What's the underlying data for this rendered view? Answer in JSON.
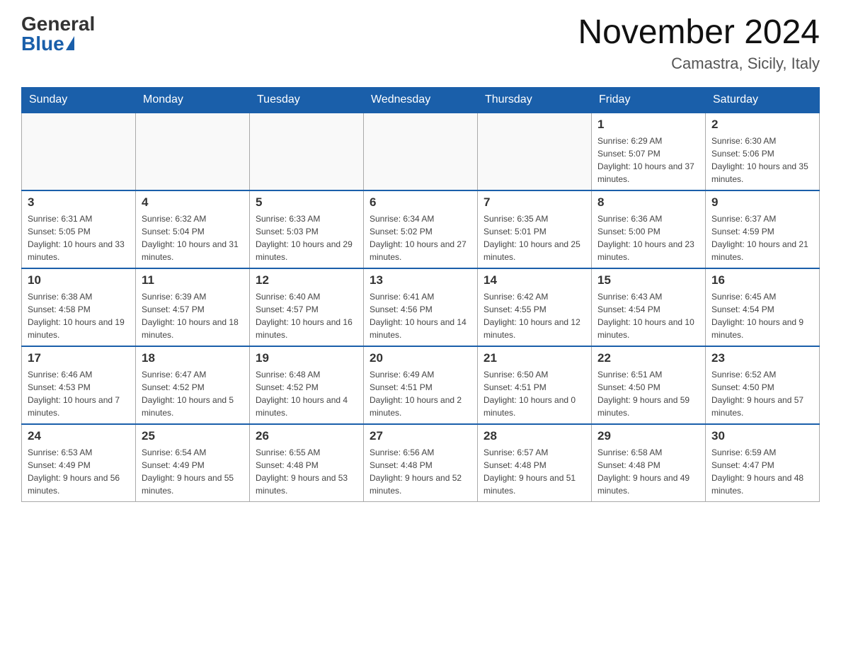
{
  "header": {
    "logo_general": "General",
    "logo_blue": "Blue",
    "month_title": "November 2024",
    "location": "Camastra, Sicily, Italy"
  },
  "days_of_week": [
    "Sunday",
    "Monday",
    "Tuesday",
    "Wednesday",
    "Thursday",
    "Friday",
    "Saturday"
  ],
  "weeks": [
    {
      "days": [
        {
          "date": "",
          "info": ""
        },
        {
          "date": "",
          "info": ""
        },
        {
          "date": "",
          "info": ""
        },
        {
          "date": "",
          "info": ""
        },
        {
          "date": "",
          "info": ""
        },
        {
          "date": "1",
          "info": "Sunrise: 6:29 AM\nSunset: 5:07 PM\nDaylight: 10 hours and 37 minutes."
        },
        {
          "date": "2",
          "info": "Sunrise: 6:30 AM\nSunset: 5:06 PM\nDaylight: 10 hours and 35 minutes."
        }
      ]
    },
    {
      "days": [
        {
          "date": "3",
          "info": "Sunrise: 6:31 AM\nSunset: 5:05 PM\nDaylight: 10 hours and 33 minutes."
        },
        {
          "date": "4",
          "info": "Sunrise: 6:32 AM\nSunset: 5:04 PM\nDaylight: 10 hours and 31 minutes."
        },
        {
          "date": "5",
          "info": "Sunrise: 6:33 AM\nSunset: 5:03 PM\nDaylight: 10 hours and 29 minutes."
        },
        {
          "date": "6",
          "info": "Sunrise: 6:34 AM\nSunset: 5:02 PM\nDaylight: 10 hours and 27 minutes."
        },
        {
          "date": "7",
          "info": "Sunrise: 6:35 AM\nSunset: 5:01 PM\nDaylight: 10 hours and 25 minutes."
        },
        {
          "date": "8",
          "info": "Sunrise: 6:36 AM\nSunset: 5:00 PM\nDaylight: 10 hours and 23 minutes."
        },
        {
          "date": "9",
          "info": "Sunrise: 6:37 AM\nSunset: 4:59 PM\nDaylight: 10 hours and 21 minutes."
        }
      ]
    },
    {
      "days": [
        {
          "date": "10",
          "info": "Sunrise: 6:38 AM\nSunset: 4:58 PM\nDaylight: 10 hours and 19 minutes."
        },
        {
          "date": "11",
          "info": "Sunrise: 6:39 AM\nSunset: 4:57 PM\nDaylight: 10 hours and 18 minutes."
        },
        {
          "date": "12",
          "info": "Sunrise: 6:40 AM\nSunset: 4:57 PM\nDaylight: 10 hours and 16 minutes."
        },
        {
          "date": "13",
          "info": "Sunrise: 6:41 AM\nSunset: 4:56 PM\nDaylight: 10 hours and 14 minutes."
        },
        {
          "date": "14",
          "info": "Sunrise: 6:42 AM\nSunset: 4:55 PM\nDaylight: 10 hours and 12 minutes."
        },
        {
          "date": "15",
          "info": "Sunrise: 6:43 AM\nSunset: 4:54 PM\nDaylight: 10 hours and 10 minutes."
        },
        {
          "date": "16",
          "info": "Sunrise: 6:45 AM\nSunset: 4:54 PM\nDaylight: 10 hours and 9 minutes."
        }
      ]
    },
    {
      "days": [
        {
          "date": "17",
          "info": "Sunrise: 6:46 AM\nSunset: 4:53 PM\nDaylight: 10 hours and 7 minutes."
        },
        {
          "date": "18",
          "info": "Sunrise: 6:47 AM\nSunset: 4:52 PM\nDaylight: 10 hours and 5 minutes."
        },
        {
          "date": "19",
          "info": "Sunrise: 6:48 AM\nSunset: 4:52 PM\nDaylight: 10 hours and 4 minutes."
        },
        {
          "date": "20",
          "info": "Sunrise: 6:49 AM\nSunset: 4:51 PM\nDaylight: 10 hours and 2 minutes."
        },
        {
          "date": "21",
          "info": "Sunrise: 6:50 AM\nSunset: 4:51 PM\nDaylight: 10 hours and 0 minutes."
        },
        {
          "date": "22",
          "info": "Sunrise: 6:51 AM\nSunset: 4:50 PM\nDaylight: 9 hours and 59 minutes."
        },
        {
          "date": "23",
          "info": "Sunrise: 6:52 AM\nSunset: 4:50 PM\nDaylight: 9 hours and 57 minutes."
        }
      ]
    },
    {
      "days": [
        {
          "date": "24",
          "info": "Sunrise: 6:53 AM\nSunset: 4:49 PM\nDaylight: 9 hours and 56 minutes."
        },
        {
          "date": "25",
          "info": "Sunrise: 6:54 AM\nSunset: 4:49 PM\nDaylight: 9 hours and 55 minutes."
        },
        {
          "date": "26",
          "info": "Sunrise: 6:55 AM\nSunset: 4:48 PM\nDaylight: 9 hours and 53 minutes."
        },
        {
          "date": "27",
          "info": "Sunrise: 6:56 AM\nSunset: 4:48 PM\nDaylight: 9 hours and 52 minutes."
        },
        {
          "date": "28",
          "info": "Sunrise: 6:57 AM\nSunset: 4:48 PM\nDaylight: 9 hours and 51 minutes."
        },
        {
          "date": "29",
          "info": "Sunrise: 6:58 AM\nSunset: 4:48 PM\nDaylight: 9 hours and 49 minutes."
        },
        {
          "date": "30",
          "info": "Sunrise: 6:59 AM\nSunset: 4:47 PM\nDaylight: 9 hours and 48 minutes."
        }
      ]
    }
  ]
}
